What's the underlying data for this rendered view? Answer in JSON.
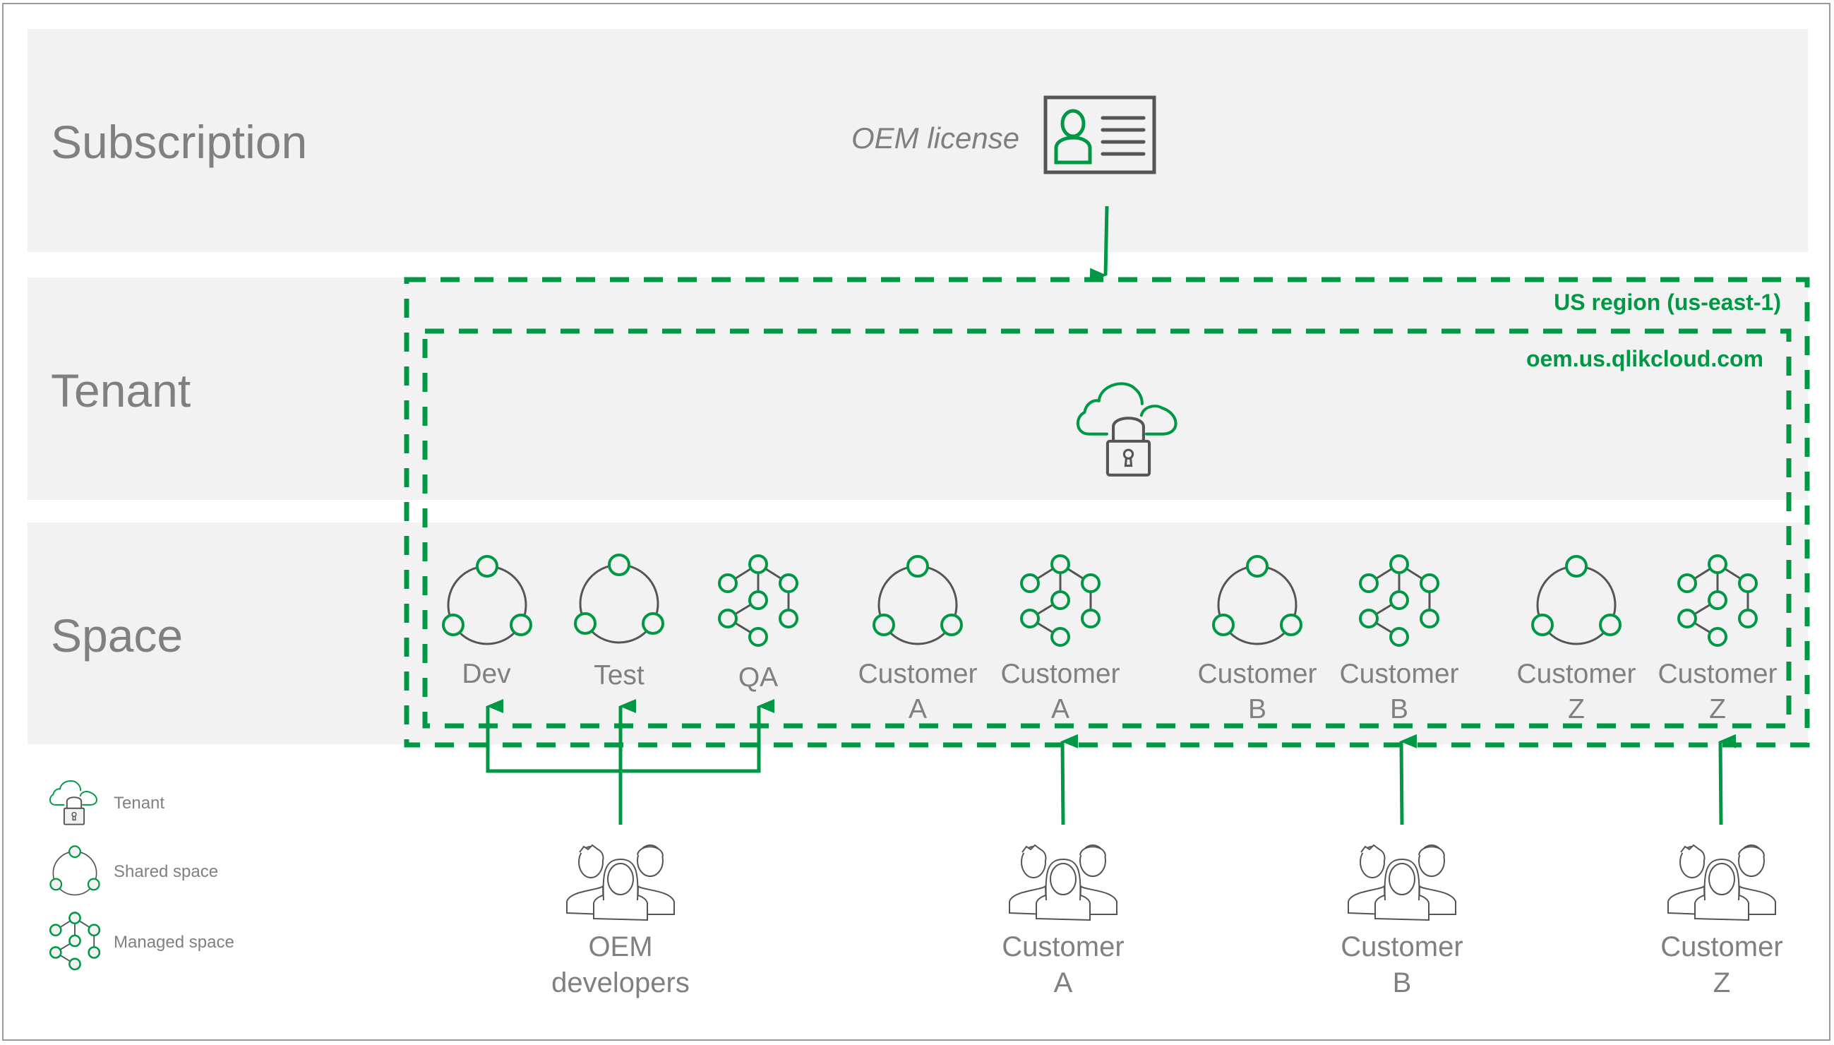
{
  "colors": {
    "accent_green": "#009845",
    "icon_gray": "#555555",
    "band_gray": "#f2f2f2",
    "text_gray": "#808080"
  },
  "bands": {
    "subscription": "Subscription",
    "tenant": "Tenant",
    "space": "Space"
  },
  "license": {
    "label": "OEM license",
    "icon": "id-card-icon"
  },
  "region": {
    "label": "US region (us-east-1)"
  },
  "tenant": {
    "hostname": "oem.us.qlikcloud.com",
    "icon": "cloud-lock-icon"
  },
  "spaces": [
    {
      "type": "shared",
      "line1": "Dev",
      "line2": ""
    },
    {
      "type": "shared",
      "line1": "Test",
      "line2": ""
    },
    {
      "type": "managed",
      "line1": "QA",
      "line2": ""
    },
    {
      "type": "shared",
      "line1": "Customer",
      "line2": "A"
    },
    {
      "type": "managed",
      "line1": "Customer",
      "line2": "A"
    },
    {
      "type": "shared",
      "line1": "Customer",
      "line2": "B"
    },
    {
      "type": "managed",
      "line1": "Customer",
      "line2": "B"
    },
    {
      "type": "shared",
      "line1": "Customer",
      "line2": "Z"
    },
    {
      "type": "managed",
      "line1": "Customer",
      "line2": "Z"
    }
  ],
  "user_groups": [
    {
      "line1": "OEM",
      "line2": "developers",
      "icon": "users-group-icon"
    },
    {
      "line1": "Customer",
      "line2": "A",
      "icon": "users-group-icon"
    },
    {
      "line1": "Customer",
      "line2": "B",
      "icon": "users-group-icon"
    },
    {
      "line1": "Customer",
      "line2": "Z",
      "icon": "users-group-icon"
    }
  ],
  "legend": [
    {
      "icon": "cloud-lock-icon",
      "label": "Tenant"
    },
    {
      "icon": "shared-space-icon",
      "label": "Shared space"
    },
    {
      "icon": "managed-space-icon",
      "label": "Managed space"
    }
  ]
}
